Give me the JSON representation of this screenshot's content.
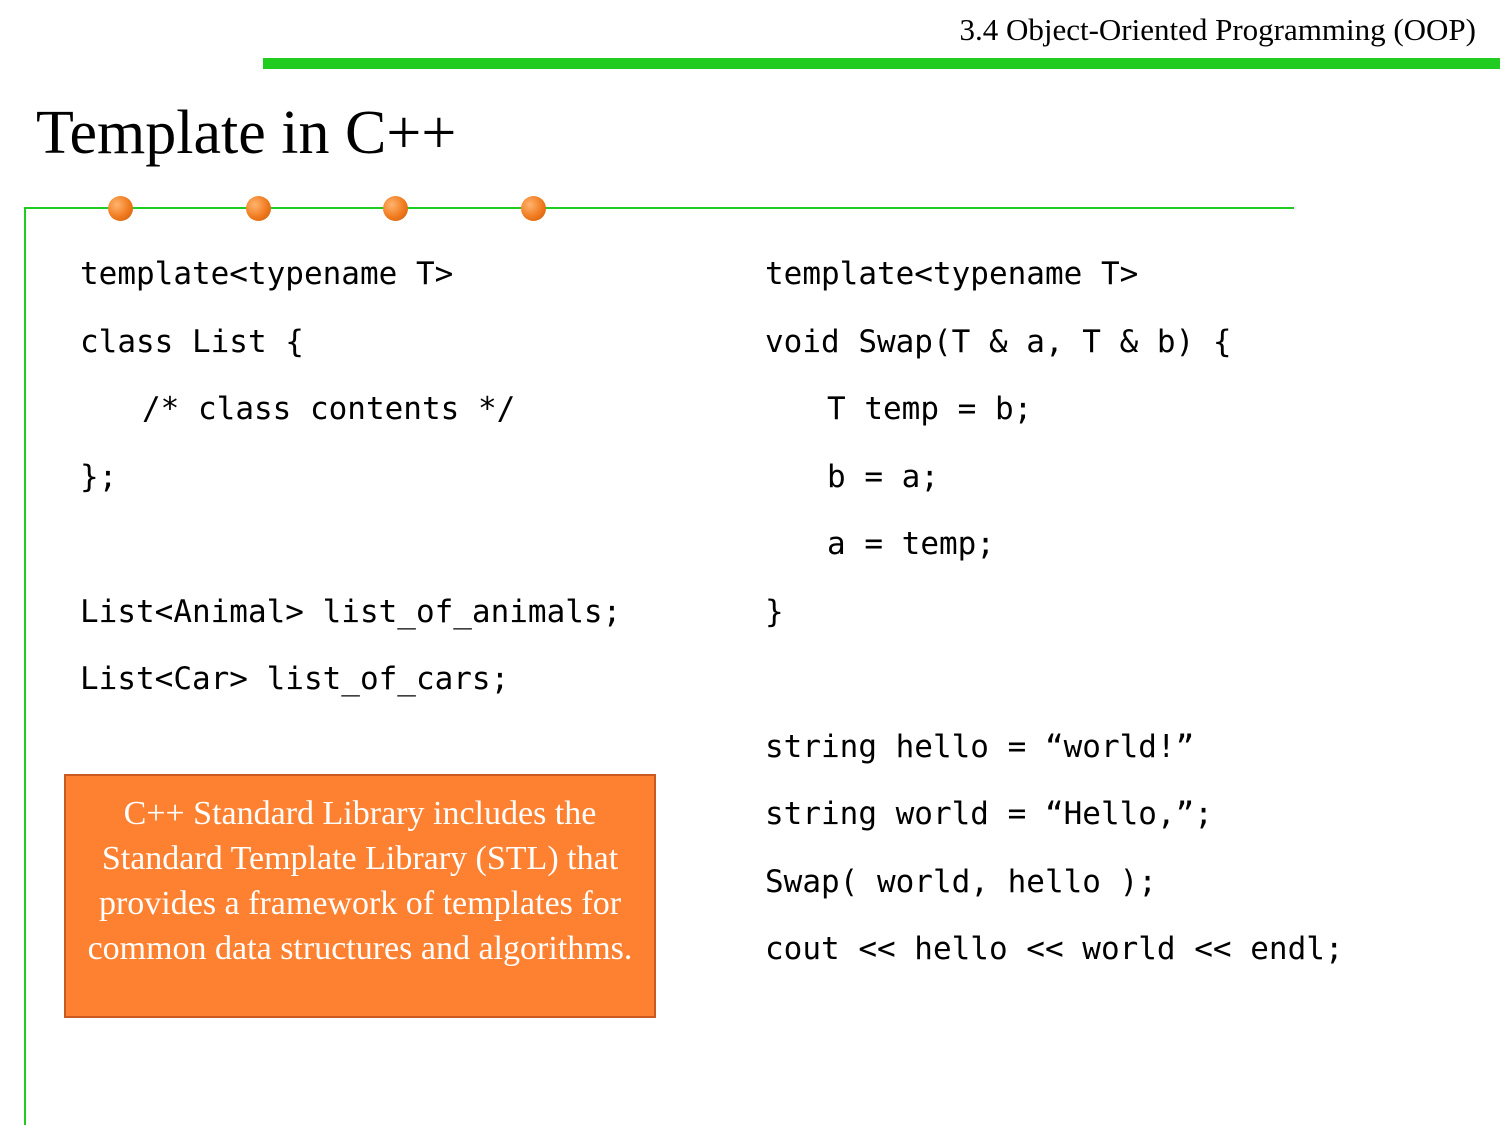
{
  "header": {
    "section": "3.4 Object-Oriented Programming (OOP)"
  },
  "title": "Template in C++",
  "left_code": [
    "template<typename T>",
    "class List {",
    "/* class contents */",
    "};",
    "",
    "List<Animal> list_of_animals;",
    "List<Car> list_of_cars;"
  ],
  "right_code": [
    "template<typename T>",
    "void Swap(T & a, T & b) {",
    "T temp = b;",
    "b = a;",
    "a = temp;",
    "}",
    "",
    "string hello = “world!”",
    "string world = “Hello,”;",
    "Swap( world, hello );",
    "cout << hello << world << endl;"
  ],
  "note": "C++ Standard Library includes the Standard Template Library (STL) that provides a framework of templates for common data structures and algorithms.",
  "colors": {
    "accent_green": "#1fcc1f",
    "accent_orange": "#fd8130",
    "dot_orange": "#f07a1e"
  }
}
